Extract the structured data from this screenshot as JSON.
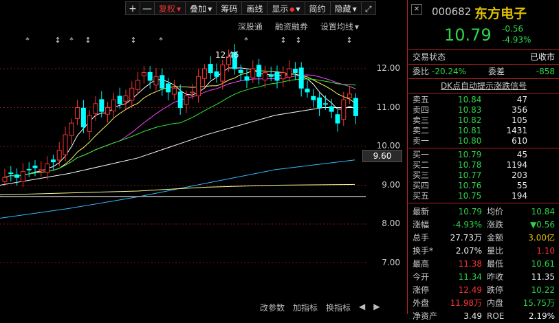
{
  "toolbar": {
    "plus": "+",
    "minus": "—",
    "fuquan": "复权",
    "diejia": "叠加",
    "choumar": "筹码",
    "huaxian": "画线",
    "xianshi": "显示",
    "jianyue": "简约",
    "yincang": "隐藏"
  },
  "subbar": {
    "shengutong": "深股通",
    "rongzi": "融资融券",
    "junxian": "设置均线"
  },
  "bottombar": {
    "gaicanshu": "改参数",
    "jiazhibiao": "加指标",
    "huanzhibiao": "换指标"
  },
  "chart": {
    "y_ticks": [
      "12.00",
      "11.00",
      "10.00",
      "9.00",
      "8.00",
      "7.00"
    ],
    "current_tag": "9.60",
    "high_label": "12.46",
    "colors": {
      "up": "#ff3333",
      "down": "#00ffff",
      "ma5": "#ffffff",
      "ma10": "#ffff66",
      "ma20": "#ff44ff",
      "ma30": "#33ee33",
      "ma60": "#ffffff",
      "ma120": "#33bbff",
      "ma250": "#ffff99"
    }
  },
  "quote": {
    "code": "000682",
    "name": "东方电子",
    "price": "10.79",
    "change": "-0.56",
    "change_pct": "-4.93%",
    "status_label": "交易状态",
    "status_value": "已收市",
    "weibi_label": "委比",
    "weibi_value": "-20.24%",
    "weicha_label": "委差",
    "weicha_value": "-858",
    "dk_signal": "DK点自动提示涨跌信号",
    "sell": [
      {
        "label": "卖五",
        "price": "10.84",
        "vol": "47"
      },
      {
        "label": "卖四",
        "price": "10.83",
        "vol": "356"
      },
      {
        "label": "卖三",
        "price": "10.82",
        "vol": "105"
      },
      {
        "label": "卖二",
        "price": "10.81",
        "vol": "1431"
      },
      {
        "label": "卖一",
        "price": "10.80",
        "vol": "610"
      }
    ],
    "buy": [
      {
        "label": "买一",
        "price": "10.79",
        "vol": "45"
      },
      {
        "label": "买二",
        "price": "10.78",
        "vol": "1194"
      },
      {
        "label": "买三",
        "price": "10.77",
        "vol": "203"
      },
      {
        "label": "买四",
        "price": "10.76",
        "vol": "55"
      },
      {
        "label": "买五",
        "price": "10.75",
        "vol": "194"
      }
    ],
    "stats": [
      {
        "l1": "最新",
        "v1": "10.79",
        "c1": "green",
        "l2": "均价",
        "v2": "10.84",
        "c2": "green"
      },
      {
        "l1": "涨幅",
        "v1": "-4.93%",
        "c1": "green",
        "l2": "涨跌",
        "v2": "▼0.56",
        "c2": "green"
      },
      {
        "l1": "总手",
        "v1": "27.73万",
        "c1": "white",
        "l2": "金额",
        "v2": "3.00亿",
        "c2": "yellow"
      },
      {
        "l1": "换手*",
        "v1": "2.07%",
        "c1": "white",
        "l2": "量比",
        "v2": "1.10",
        "c2": "red"
      },
      {
        "l1": "最高",
        "v1": "11.38",
        "c1": "red",
        "l2": "最低",
        "v2": "10.61",
        "c2": "green"
      },
      {
        "l1": "今开",
        "v1": "11.34",
        "c1": "green",
        "l2": "昨收",
        "v2": "11.35",
        "c2": "white"
      },
      {
        "l1": "涨停",
        "v1": "12.49",
        "c1": "red",
        "l2": "跌停",
        "v2": "10.22",
        "c2": "green"
      },
      {
        "l1": "外盘",
        "v1": "11.98万",
        "c1": "red",
        "l2": "内盘",
        "v2": "15.75万",
        "c2": "green"
      },
      {
        "l1": "净资产",
        "v1": "3.49",
        "c1": "white",
        "l2": "ROE",
        "v2": "2.19%",
        "c2": "white"
      }
    ]
  }
}
